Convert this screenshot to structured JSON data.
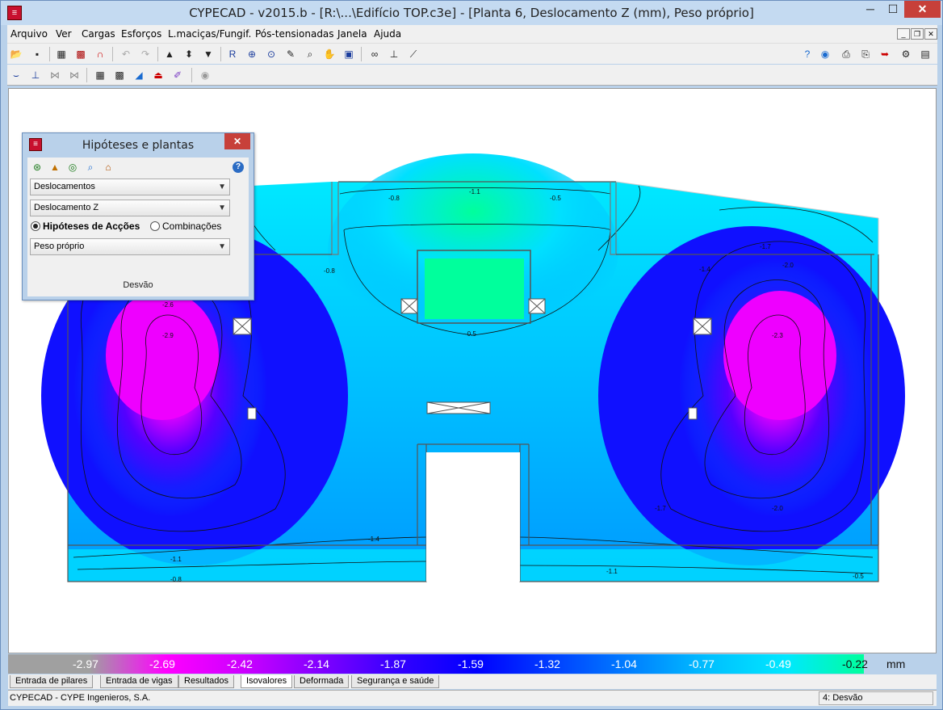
{
  "window": {
    "title": "CYPECAD - v2015.b - [R:\\...\\Edifício TOP.c3e] - [Planta 6, Deslocamento Z (mm), Peso próprio]",
    "minimize": "─",
    "maximize": "☐",
    "close": "✕"
  },
  "menu": {
    "items": [
      "Arquivo",
      "Ver",
      "Cargas",
      "Esforços",
      "L.maciças/Fungif.",
      "Pós-tensionadas",
      "Janela",
      "Ajuda"
    ]
  },
  "toolbar1": {
    "icons": [
      "open-icon",
      "save-icon",
      "export-icon",
      "grid-icon",
      "magnet-icon",
      "undo-icon",
      "redo-icon",
      "up-arrow-icon",
      "up-down-arrow-icon",
      "down-arrow-icon",
      "redraw-icon",
      "zoom-window-icon",
      "zoom-extent-icon",
      "pencil-icon",
      "zoom-icon",
      "pan-hand-icon",
      "layers-icon",
      "binoculars-icon",
      "dimension-icon",
      "measure-icon"
    ],
    "right_icons": [
      "help-icon",
      "globe-icon",
      "print-icon",
      "print-preview-icon",
      "exit-icon",
      "settings-icon"
    ]
  },
  "toolbar2": {
    "icons": [
      "beam-icon",
      "column-icon",
      "slab-icon",
      "ribbed-slab-icon",
      "table-icon",
      "grid-table-icon",
      "diagram-icon",
      "load-icon",
      "eraser-icon",
      "eye-icon"
    ]
  },
  "panel": {
    "title": "Hipóteses e plantas",
    "close": "✕",
    "combo1": "Deslocamentos",
    "combo2": "Deslocamento Z",
    "radio1": "Hipóteses de Acções",
    "radio2": "Combinações",
    "combo3": "Peso próprio",
    "footer": "Desvão",
    "help": "?",
    "icons": [
      "plant-icon",
      "chart-icon",
      "target-icon",
      "magnify-icon",
      "building-icon"
    ]
  },
  "legend": {
    "values": [
      "-2.97",
      "-2.69",
      "-2.42",
      "-2.14",
      "-1.87",
      "-1.59",
      "-1.32",
      "-1.04",
      "-0.77",
      "-0.49",
      "-0.22"
    ],
    "colors": [
      "#a0a0a0",
      "#ff00ff",
      "#cc00ff",
      "#8000ff",
      "#3300ff",
      "#0000ff",
      "#0040ff",
      "#0080ff",
      "#00c0ff",
      "#00e8ff",
      "#00ff9c"
    ],
    "unit": "mm"
  },
  "contours": {
    "labels": [
      "-1.1",
      "-0.8",
      "-0.5",
      "-0.8",
      "-1.4",
      "-1.7",
      "-2.0",
      "-2.6",
      "-2.9",
      "-0.5",
      "-0.8",
      "-1.1",
      "-1.4",
      "-2.3",
      "-2.0",
      "-1.7",
      "-1.1",
      "-0.5"
    ]
  },
  "tabs": [
    "Entrada de pilares",
    "Entrada de vigas",
    "Resultados",
    "Isovalores",
    "Deformada",
    "Segurança e saúde"
  ],
  "status": {
    "left": "CYPECAD - CYPE Ingenieros, S.A.",
    "right": "4: Desvão"
  }
}
